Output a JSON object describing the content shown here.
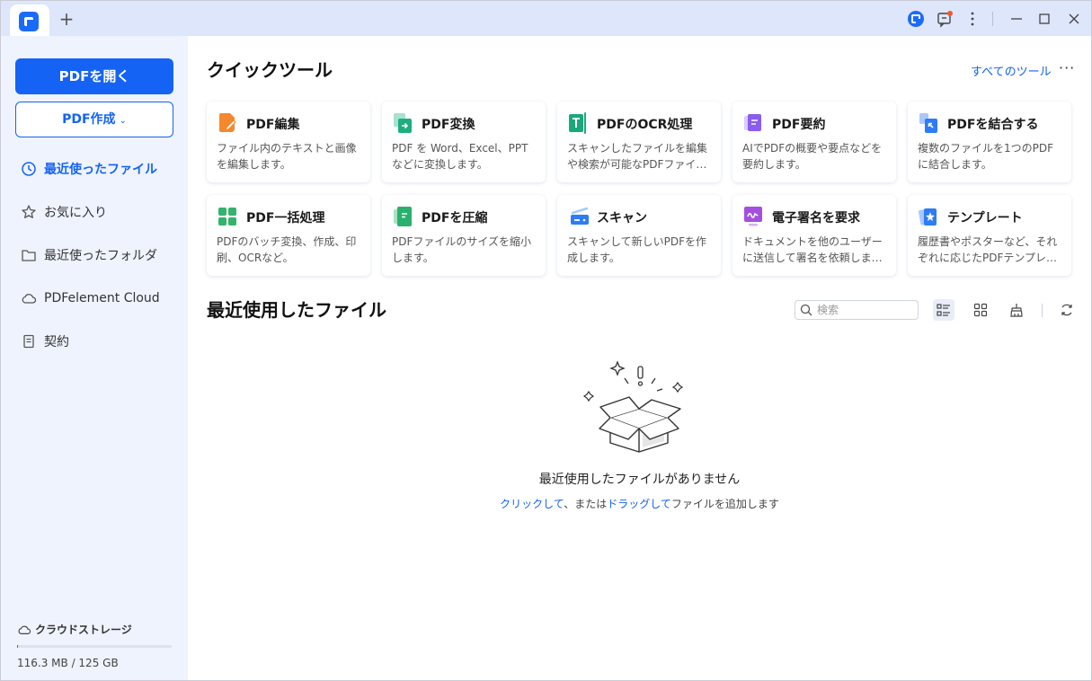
{
  "titlebar": {
    "new_tab": "+"
  },
  "sidebar": {
    "open_pdf": "PDFを開く",
    "create_pdf": "PDF作成",
    "create_chevron": "⌄",
    "items": [
      {
        "label": "最近使ったファイル",
        "icon": "clock-icon",
        "active": true
      },
      {
        "label": "お気に入り",
        "icon": "star-icon",
        "active": false
      },
      {
        "label": "最近使ったフォルダ",
        "icon": "folder-icon",
        "active": false
      },
      {
        "label": "PDFelement Cloud",
        "icon": "cloud-icon",
        "active": false
      },
      {
        "label": "契約",
        "icon": "document-icon",
        "active": false
      }
    ],
    "storage": {
      "label": "クラウドストレージ",
      "value": "116.3 MB / 125 GB",
      "used_fraction": 0.0009
    }
  },
  "quick_tools": {
    "heading": "クイックツール",
    "all_tools": "すべてのツール",
    "more": "···",
    "cards": [
      {
        "title": "PDF編集",
        "desc": "ファイル内のテキストと画像を編集します。",
        "icon": "edit-pdf-icon",
        "color": "#f5882a"
      },
      {
        "title": "PDF変換",
        "desc": "PDF を Word、Excel、PPT などに変換します。",
        "icon": "convert-pdf-icon",
        "color": "#1eae7e"
      },
      {
        "title": "PDFのOCR処理",
        "desc": "スキャンしたファイルを編集や検索が可能なPDFファイ…",
        "icon": "ocr-icon",
        "color": "#1aa87a"
      },
      {
        "title": "PDF要約",
        "desc": "AIでPDFの概要や要点などを要約します。",
        "icon": "summarize-icon",
        "color": "#8a5cf0"
      },
      {
        "title": "PDFを結合する",
        "desc": "複数のファイルを1つのPDFに結合します。",
        "icon": "merge-icon",
        "color": "#2d7cf6"
      },
      {
        "title": "PDF一括処理",
        "desc": "PDFのバッチ変換、作成、印刷、OCRなど。",
        "icon": "batch-icon",
        "color": "#33b36b"
      },
      {
        "title": "PDFを圧縮",
        "desc": "PDFファイルのサイズを縮小します。",
        "icon": "compress-icon",
        "color": "#2ab06e"
      },
      {
        "title": "スキャン",
        "desc": "スキャンして新しいPDFを作成します。",
        "icon": "scan-icon",
        "color": "#2d7cf6"
      },
      {
        "title": "電子署名を要求",
        "desc": "ドキュメントを他のユーザーに送信して署名を依頼しま…",
        "icon": "esign-icon",
        "color": "#a54fe0"
      },
      {
        "title": "テンプレート",
        "desc": "履歴書やポスターなど、それぞれに応じたPDFテンプレ…",
        "icon": "template-icon",
        "color": "#2d7cf6"
      }
    ]
  },
  "recent": {
    "heading": "最近使用したファイル",
    "search_placeholder": "検索",
    "empty_title": "最近使用したファイルがありません",
    "empty_click": "クリックして",
    "empty_mid": "、または",
    "empty_drag": "ドラッグして",
    "empty_end": "ファイルを追加します"
  }
}
